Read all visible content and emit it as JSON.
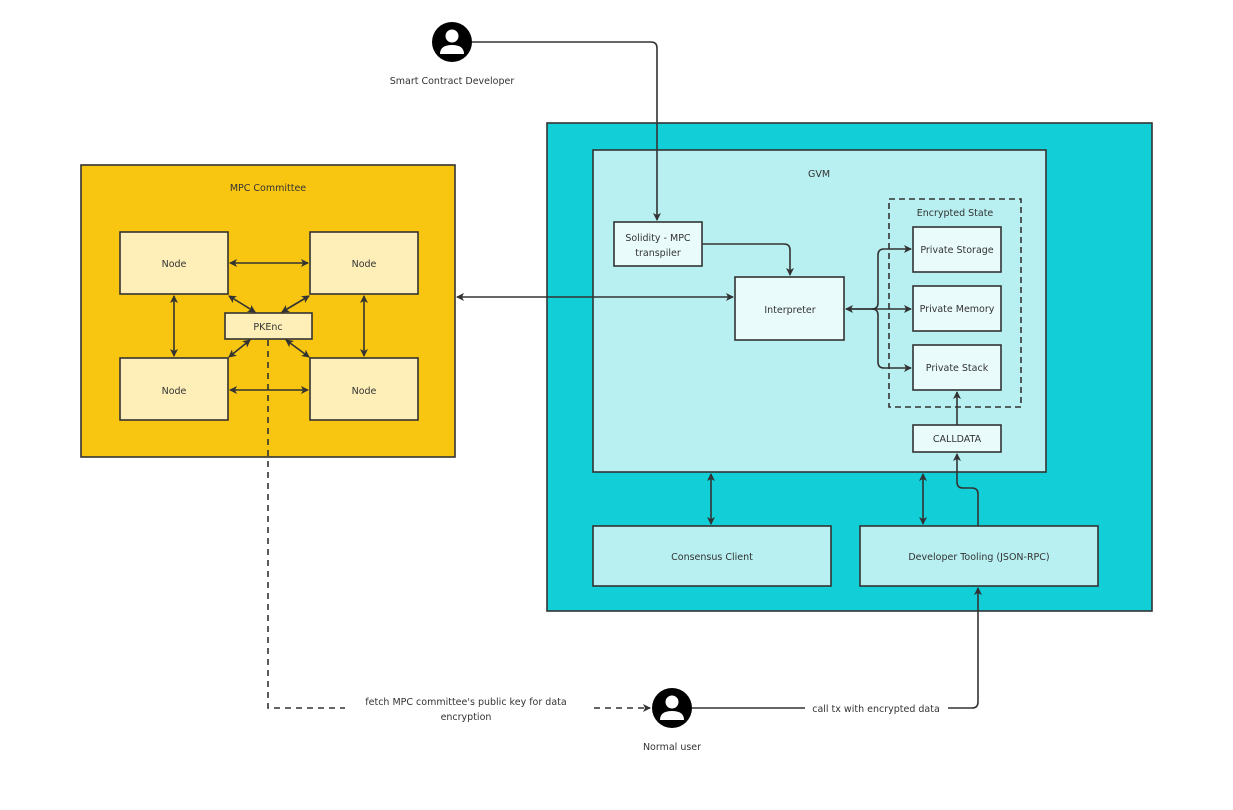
{
  "actors": {
    "developer": {
      "label": "Smart Contract Developer",
      "icon": "person-icon"
    },
    "user": {
      "label": "Normal user",
      "icon": "person-icon"
    }
  },
  "mpc": {
    "title": "MPC Committee",
    "nodes": [
      "Node",
      "Node",
      "Node",
      "Node"
    ],
    "pkenc": "PKEnc"
  },
  "chain": {
    "gvm": {
      "title": "GVM",
      "transpiler": [
        "Solidity - MPC",
        "transpiler"
      ],
      "interpreter": "Interpreter",
      "encrypted_state": {
        "title": "Encrypted State",
        "items": [
          "Private Storage",
          "Private Memory",
          "Private Stack"
        ]
      },
      "calldata": "CALLDATA"
    },
    "consensus": "Consensus Client",
    "tooling": "Developer Tooling (JSON-RPC)"
  },
  "edges": {
    "fetch_key": [
      "fetch MPC committee's public key for data",
      "encryption"
    ],
    "call_tx": "call tx with encrypted data"
  },
  "colors": {
    "mpc_bg": "#F8C611",
    "node_bg": "#FEEFB9",
    "chain_bg": "#12CED6",
    "gvm_bg": "#B8EFF0",
    "inner_bg": "#E9FBFB"
  }
}
